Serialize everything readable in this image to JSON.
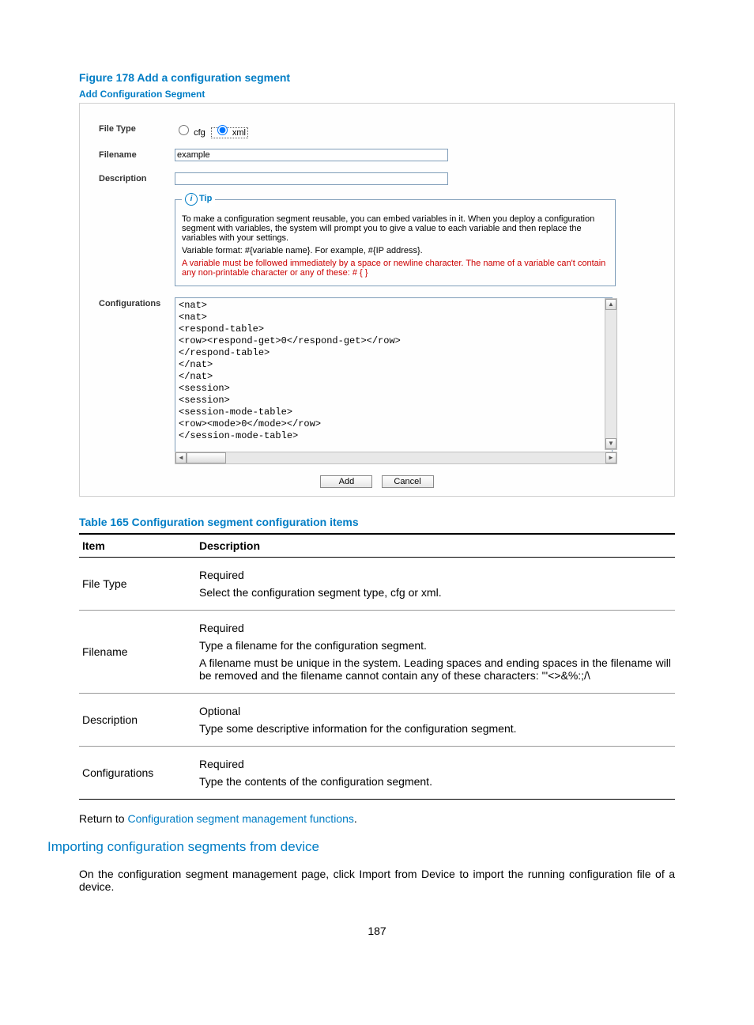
{
  "figure": {
    "title": "Figure 178 Add a configuration segment"
  },
  "panel": {
    "title": "Add Configuration Segment",
    "labels": {
      "file_type": "File Type",
      "filename": "Filename",
      "description": "Description",
      "configurations": "Configurations"
    },
    "file_type": {
      "cfg": "cfg",
      "xml": "xml",
      "selected": "xml"
    },
    "filename_value": "example",
    "description_value": "",
    "tip": {
      "legend": "Tip",
      "p1": "To make a configuration segment reusable, you can embed variables in it. When you deploy a configuration segment with variables, the system will prompt you to give a value to each variable and then replace the variables with your settings.",
      "p2": "Variable format: #{variable name}. For example, #{IP address}.",
      "p3": "A variable must be followed immediately by a space or newline character. The name of a variable can't contain any non-printable character or any of these: # { }"
    },
    "config_code": "<nat>\n<nat>\n<respond-table>\n<row><respond-get>0</respond-get></row>\n</respond-table>\n</nat>\n</nat>\n<session>\n<session>\n<session-mode-table>\n<row><mode>0</mode></row>\n</session-mode-table>",
    "buttons": {
      "add": "Add",
      "cancel": "Cancel"
    }
  },
  "table": {
    "title": "Table 165 Configuration segment configuration items",
    "head": {
      "item": "Item",
      "desc": "Description"
    },
    "rows": [
      {
        "item": "File Type",
        "d1": "Required",
        "d2": "Select the configuration segment type, cfg or xml."
      },
      {
        "item": "Filename",
        "d1": "Required",
        "d2": "Type a filename for the configuration segment.",
        "d3": "A filename must be unique in the system. Leading spaces and ending spaces in the filename will be removed and the filename cannot contain any of these characters: '\"<>&%:;/\\"
      },
      {
        "item": "Description",
        "d1": "Optional",
        "d2": "Type some descriptive information for the configuration segment."
      },
      {
        "item": "Configurations",
        "d1": "Required",
        "d2": "Type the contents of the configuration segment."
      }
    ]
  },
  "return": {
    "prefix": "Return to ",
    "link": "Configuration segment management functions",
    "suffix": "."
  },
  "heading2": "Importing configuration segments from device",
  "body2a": "On the configuration segment management page, click ",
  "body2_bold": "Import from Device",
  "body2b": " to import the running configuration file of a device.",
  "page_num": "187"
}
